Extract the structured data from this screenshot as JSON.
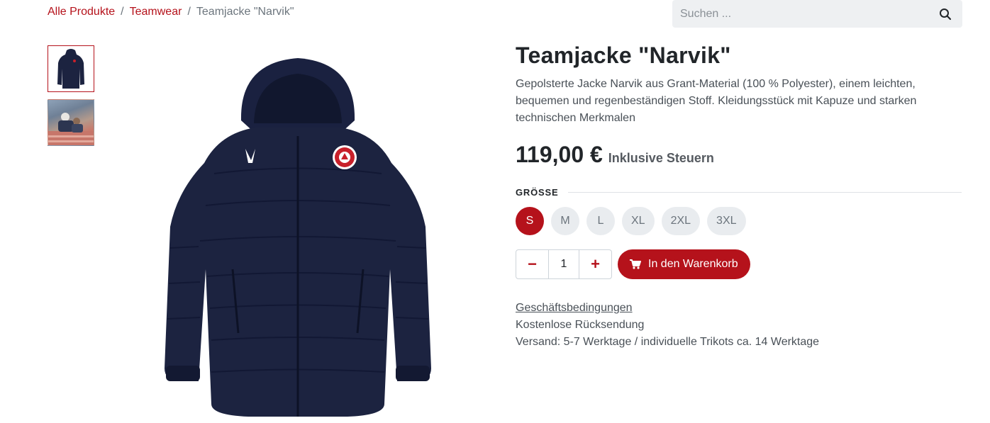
{
  "breadcrumb": {
    "items": [
      "Alle Produkte",
      "Teamwear"
    ],
    "separator": "/",
    "current": "Teamjacke \"Narvik\""
  },
  "search": {
    "placeholder": "Suchen ...",
    "value": "",
    "icon": "search-icon"
  },
  "gallery": {
    "thumbnails": [
      "jacket-image",
      "stadium-photo"
    ],
    "active_index": 0
  },
  "product": {
    "title": "Teamjacke \"Narvik\"",
    "description": "Gepolsterte Jacke Narvik aus Grant-Material (100 % Polyester), einem leichten, bequemen und regenbeständigen Stoff. Kleidungsstück mit Kapuze und starken technischen Merkmalen",
    "price": "119,00 €",
    "tax_note": "Inklusive Steuern"
  },
  "attributes": {
    "size_label": "GRÖSSE",
    "sizes": [
      "S",
      "M",
      "L",
      "XL",
      "2XL",
      "3XL"
    ],
    "selected": "S"
  },
  "cart": {
    "minus_label": "−",
    "plus_label": "+",
    "quantity": "1",
    "add_label": "In den Warenkorb",
    "icon": "cart-icon"
  },
  "info": {
    "terms_link": "Geschäftsbedingungen",
    "returns": "Kostenlose Rücksendung",
    "shipping": "Versand: 5-7 Werktage / individuelle Trikots ca. 14 Werktage"
  },
  "colors": {
    "accent": "#b5121b",
    "jacket": "#1c2340",
    "pill_bg": "#e9ecef",
    "search_bg": "#eef0f2"
  }
}
